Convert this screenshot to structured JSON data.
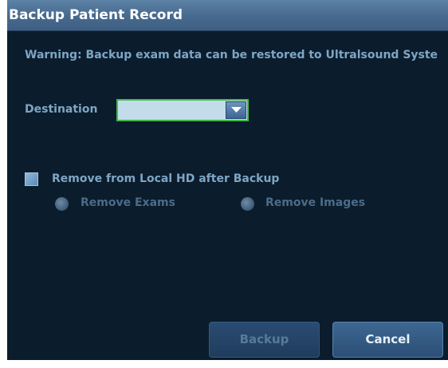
{
  "dialog": {
    "title": "Backup Patient Record",
    "warning": "Warning: Backup exam data can be restored to Ultralsound Syste"
  },
  "destination": {
    "label": "Destination",
    "selected_value": ""
  },
  "remove_option": {
    "checkbox_label": "Remove from Local HD after Backup",
    "checked": false,
    "radios": [
      {
        "label": "Remove Exams",
        "enabled": false
      },
      {
        "label": "Remove Images",
        "enabled": false
      }
    ]
  },
  "buttons": {
    "backup_label": "Backup",
    "cancel_label": "Cancel"
  },
  "colors": {
    "background": "#0b1c2c",
    "titlebar": "#46698d",
    "label_text": "#7ea6c4",
    "focus_border": "#43b84a",
    "select_fill": "#c2dde9"
  }
}
